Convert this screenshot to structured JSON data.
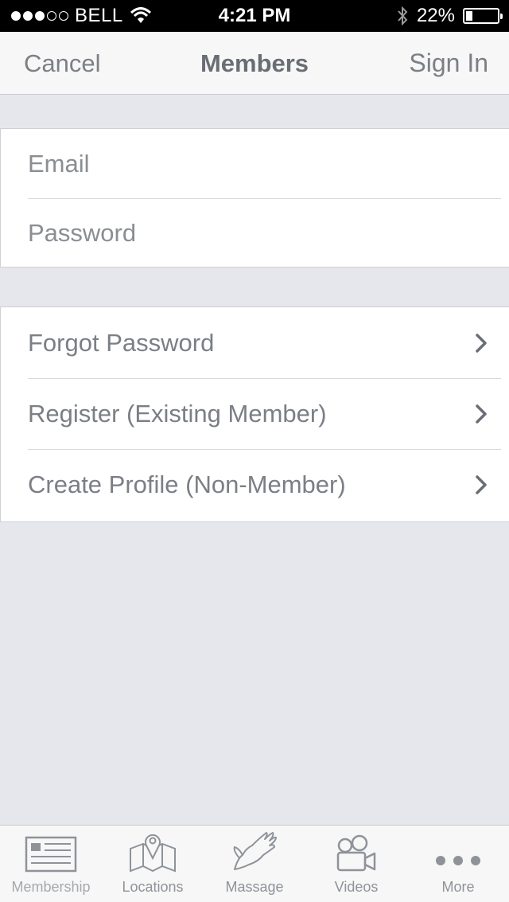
{
  "status_bar": {
    "carrier": "BELL",
    "time": "4:21 PM",
    "battery_text": "22%",
    "battery_level": 0.22,
    "signal_bars_filled": 3,
    "signal_bars_total": 5
  },
  "nav": {
    "cancel_label": "Cancel",
    "title": "Members",
    "signin_label": "Sign In"
  },
  "form": {
    "email_placeholder": "Email",
    "password_placeholder": "Password"
  },
  "links": [
    {
      "label": "Forgot Password"
    },
    {
      "label": "Register (Existing Member)"
    },
    {
      "label": "Create Profile (Non-Member)"
    }
  ],
  "tabs": [
    {
      "label": "Membership",
      "icon": "membership-card-icon",
      "active": true
    },
    {
      "label": "Locations",
      "icon": "map-pin-icon",
      "active": false
    },
    {
      "label": "Massage",
      "icon": "hand-icon",
      "active": false
    },
    {
      "label": "Videos",
      "icon": "video-camera-icon",
      "active": false
    },
    {
      "label": "More",
      "icon": "more-dots-icon",
      "active": false
    }
  ],
  "colors": {
    "background": "#e6e7ec",
    "status_bar": "#000000",
    "nav_bar": "#f7f7f7",
    "text": "#7b7f85",
    "chevron": "#6a6e76"
  }
}
